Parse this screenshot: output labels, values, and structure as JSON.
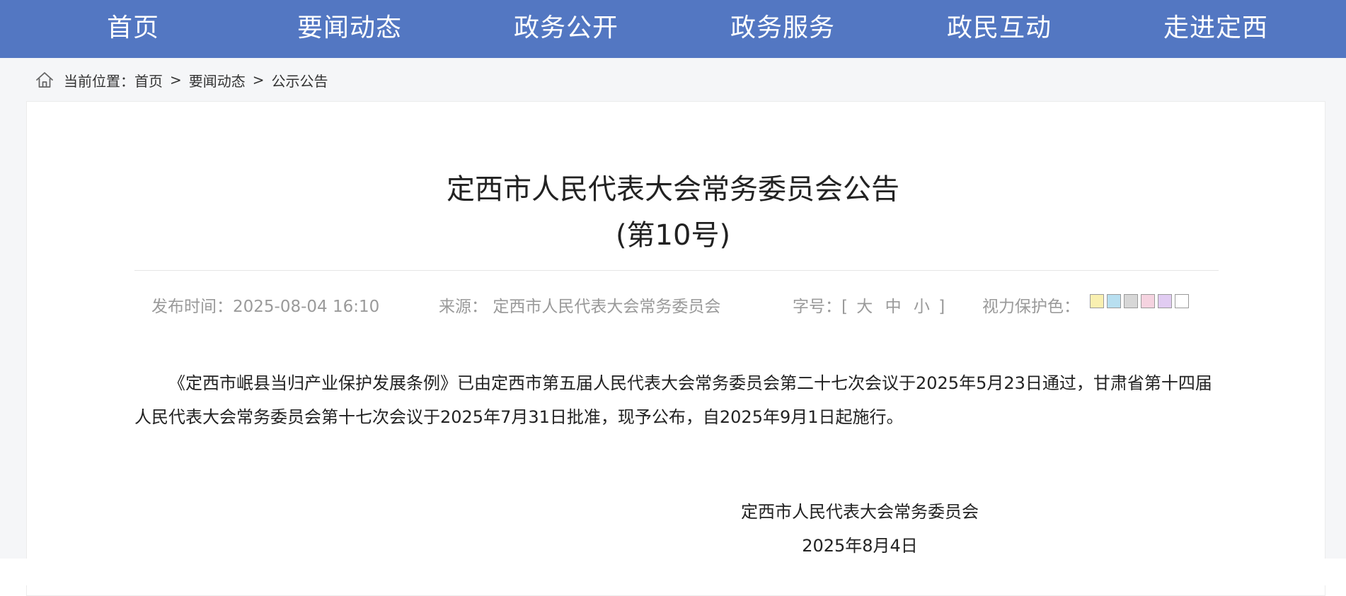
{
  "nav": {
    "items": [
      {
        "label": "首页"
      },
      {
        "label": "要闻动态"
      },
      {
        "label": "政务公开"
      },
      {
        "label": "政务服务"
      },
      {
        "label": "政民互动"
      },
      {
        "label": "走进定西"
      }
    ],
    "background": "#5377c2"
  },
  "breadcrumb": {
    "icon": "home-icon",
    "prefix": "当前位置：",
    "items": [
      "首页",
      "要闻动态",
      "公示公告"
    ],
    "separator": ">"
  },
  "article": {
    "title": "定西市人民代表大会常务委员会公告",
    "subtitle": "(第10号)",
    "meta": {
      "publish_label": "发布时间：",
      "publish_time": "2025-08-04 16:10",
      "source_label": "来源：",
      "source": "定西市人民代表大会常务委员会",
      "font_label": "字号：",
      "font_open": "[",
      "font_sizes": [
        "大",
        "中",
        "小"
      ],
      "font_close": "]",
      "eye_label": "视力保护色：",
      "eye_colors": [
        "#f9f0b1",
        "#b8dff0",
        "#d7d7d7",
        "#f5d3e0",
        "#e1ccf2",
        "#ffffff"
      ]
    },
    "body": "《定西市岷县当归产业保护发展条例》已由定西市第五届人民代表大会常务委员会第二十七次会议于2025年5月23日通过，甘肃省第十四届人民代表大会常务委员会第十七次会议于2025年7月31日批准，现予公布，自2025年9月1日起施行。",
    "signature": {
      "org": "定西市人民代表大会常务委员会",
      "date": "2025年8月4日"
    }
  }
}
